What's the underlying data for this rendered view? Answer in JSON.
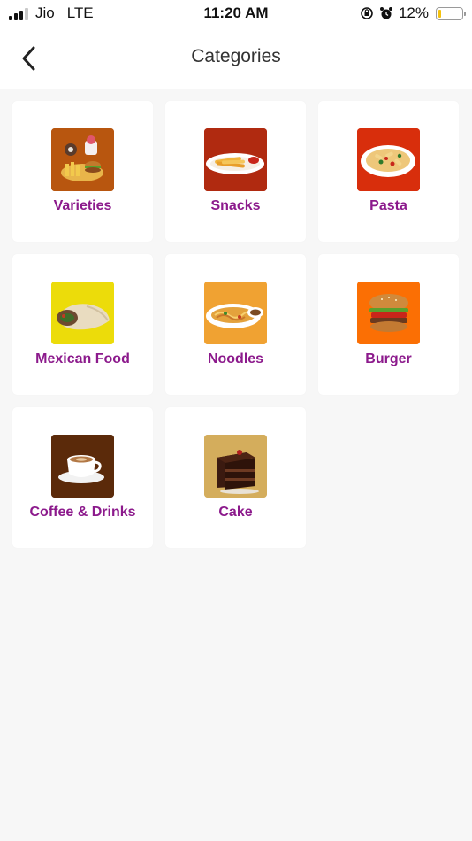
{
  "status_bar": {
    "carrier": "Jio",
    "network": "LTE",
    "time": "11:20 AM",
    "battery": "12%",
    "battery_level": 0.12,
    "battery_color": "#f4c20d"
  },
  "header": {
    "title": "Categories",
    "back_icon": "chevron-left-icon"
  },
  "colors": {
    "label": "#8c1a8c",
    "background": "#f7f7f7",
    "card": "#ffffff"
  },
  "categories": [
    {
      "label": "Varieties",
      "thumb_bg": "#b8560f",
      "icon": "varieties-food-icon"
    },
    {
      "label": "Snacks",
      "thumb_bg": "#b02a10",
      "icon": "snacks-fries-icon"
    },
    {
      "label": "Pasta",
      "thumb_bg": "#d82e0c",
      "icon": "pasta-plate-icon"
    },
    {
      "label": "Mexican Food",
      "thumb_bg": "#ecdc0a",
      "icon": "wrap-icon"
    },
    {
      "label": "Noodles",
      "thumb_bg": "#f0a232",
      "icon": "noodles-plate-icon"
    },
    {
      "label": "Burger",
      "thumb_bg": "#fb6f04",
      "icon": "burger-icon"
    },
    {
      "label": "Coffee & Drinks",
      "thumb_bg": "#5b2a0a",
      "icon": "coffee-cup-icon"
    },
    {
      "label": "Cake",
      "thumb_bg": "#d4ad5c",
      "icon": "cake-slice-icon"
    }
  ]
}
